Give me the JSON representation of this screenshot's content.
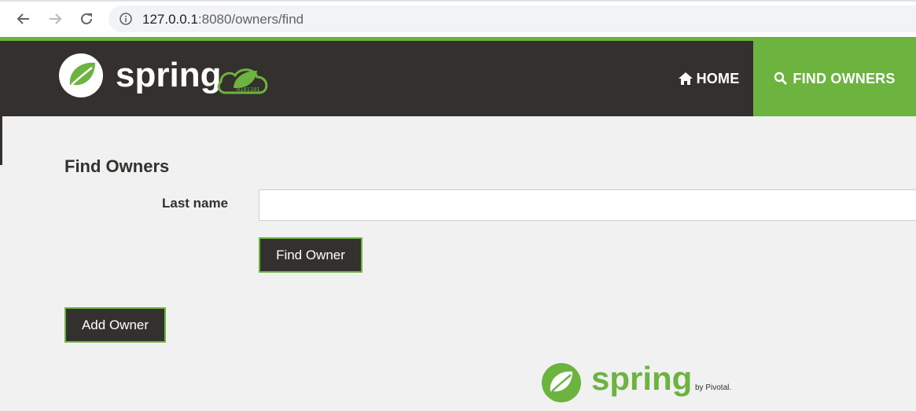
{
  "browser": {
    "url_host": "127.0.0.1",
    "url_path": ":8080/owners/find",
    "back_icon": "arrow-left-icon",
    "forward_icon": "arrow-right-icon",
    "reload_icon": "reload-icon",
    "info_icon": "info-icon"
  },
  "navbar": {
    "brand": "spring",
    "home_label": "HOME",
    "find_owners_label": "FIND OWNERS",
    "home_icon": "home-icon",
    "search_icon": "search-icon"
  },
  "main": {
    "title": "Find Owners",
    "last_name_label": "Last name",
    "last_name_value": "",
    "find_button": "Find Owner",
    "add_button": "Add Owner"
  },
  "footer": {
    "brand": "spring",
    "byline": "by Pivotal."
  },
  "colors": {
    "brand_green": "#6db33f",
    "navbar_dark": "#34302d",
    "page_bg": "#f1f1f1"
  }
}
